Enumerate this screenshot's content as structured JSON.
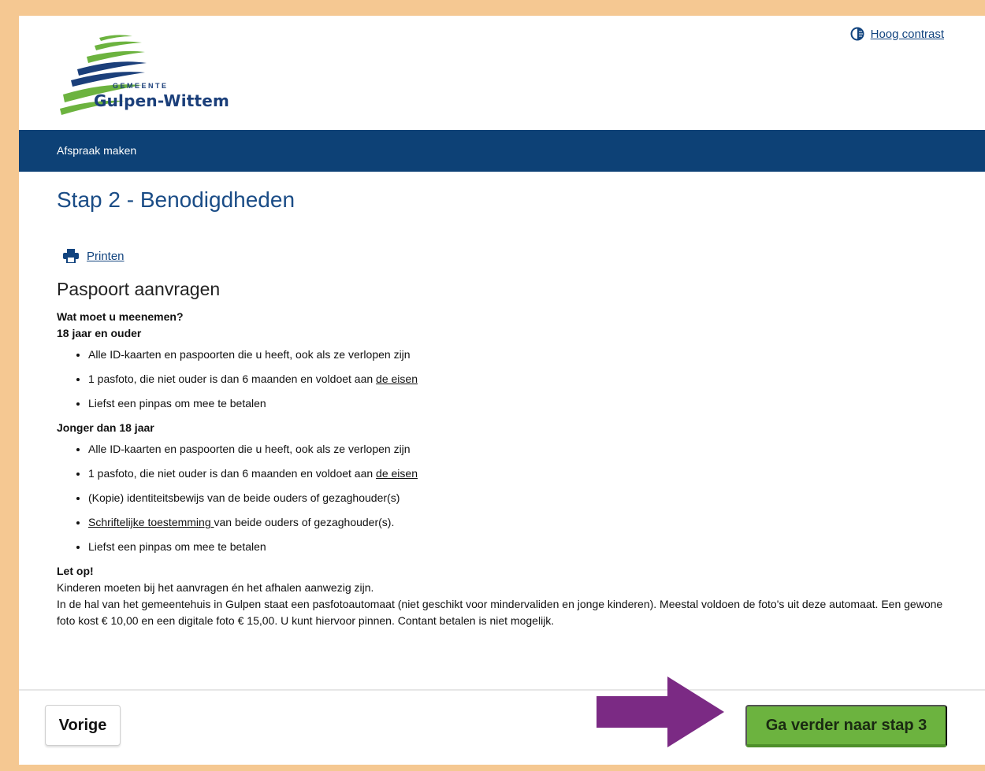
{
  "header": {
    "contrast_label": "Hoog contrast",
    "logo_small": "GEMEENTE",
    "logo_name": "Gulpen-Wittem"
  },
  "nav": {
    "item": "Afspraak maken"
  },
  "step_title": "Stap 2 - Benodigdheden",
  "print_label": "Printen",
  "section_title": "Paspoort aanvragen",
  "content": {
    "question": "Wat moet u meenemen?",
    "group1": {
      "heading": "18 jaar en ouder",
      "items": [
        {
          "text": "Alle ID-kaarten en paspoorten die u heeft, ook als ze verlopen zijn"
        },
        {
          "text": "1 pasfoto, die niet ouder is dan 6 maanden en voldoet aan ",
          "link": "de eisen"
        },
        {
          "text": "Liefst een pinpas om mee te betalen"
        }
      ]
    },
    "group2": {
      "heading": "Jonger dan 18 jaar",
      "items": [
        {
          "text": "Alle ID-kaarten en paspoorten die u heeft, ook als ze verlopen zijn"
        },
        {
          "text": "1 pasfoto, die niet ouder is dan 6 maanden en voldoet aan ",
          "link": "de eisen"
        },
        {
          "text": "(Kopie) identiteitsbewijs van de beide ouders of gezaghouder(s)"
        },
        {
          "link": "Schriftelijke toestemming ",
          "text": "van beide ouders of gezaghouder(s)."
        },
        {
          "text": "Liefst een pinpas om mee te betalen"
        }
      ]
    },
    "note_heading": "Let op!",
    "note_line1": "Kinderen moeten bij het aanvragen én het afhalen aanwezig zijn.",
    "note_line2": "In de hal van het gemeentehuis in Gulpen staat een pasfotoautomaat (niet geschikt voor mindervaliden en jonge kinderen). Meestal voldoen de foto's uit deze automaat. Een gewone foto kost € 10,00 en een digitale foto € 15,00. U kunt hiervoor pinnen. Contant betalen is niet mogelijk."
  },
  "footer": {
    "prev_label": "Vorige",
    "next_label": "Ga verder naar stap 3"
  },
  "colors": {
    "frame": "#f5c892",
    "nav_bg": "#0d4176",
    "next_button": "#6cb33f",
    "arrow": "#7b2a84"
  }
}
